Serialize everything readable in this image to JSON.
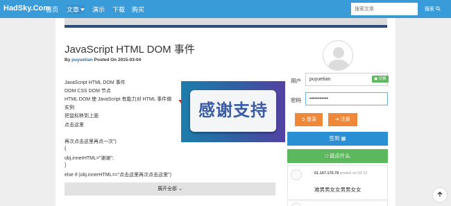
{
  "navbar": {
    "brand": "HadSky.Com",
    "items": [
      "首页",
      "文章",
      "演示",
      "下载",
      "购买"
    ],
    "search_placeholder": "搜索文章",
    "search_button": "搜索"
  },
  "article": {
    "title": "JavaScript HTML DOM 事件",
    "byline_prefix": "By",
    "author": "puyuetian",
    "byline_suffix": "Posted On 2015-03-04",
    "lines": [
      "JavaScript HTML DOM 事件",
      "DOM CSS DOM 节点",
      "HTML DOM 使 JavaScript 有能力对 HTML 事件做",
      "实例",
      "把鼠标移到上面",
      "点击这里",
      "再次点击这里再点一次\")",
      "{",
      "obj.innerHTML=\"谢谢\";",
      "}",
      "else if (obj.innerHTML==\"点击这里再次点击这里\")"
    ],
    "expand_label": "展开全部"
  },
  "thanks_overlay": {
    "text": "感谢支持"
  },
  "sidebar": {
    "username_label": "用户",
    "username_value": "puyuetian",
    "switch_label": "切换",
    "password_label": "密码",
    "password_value": "•••••••••••",
    "login_button": "登录",
    "register_button": "注册",
    "signin_button": "签到",
    "say_button": "说点什么"
  },
  "comments": [
    {
      "ip": "61.167.176.78",
      "posted_on": "posted on",
      "date": "03-12",
      "text": "难男男女女男男女女"
    }
  ],
  "colors": {
    "navbar": "#3a9bd9",
    "orange": "#f0883a",
    "blue": "#2b8fd3",
    "green": "#5cb85c"
  }
}
